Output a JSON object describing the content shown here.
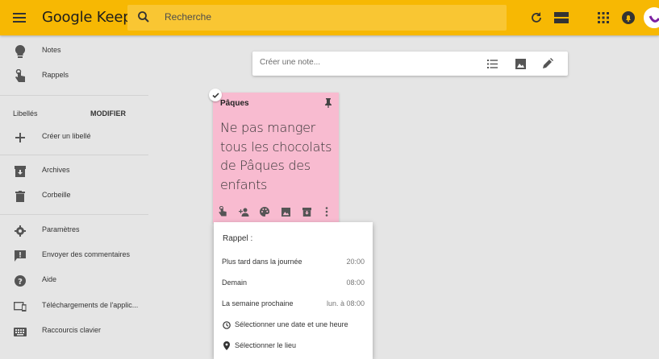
{
  "header": {
    "brand": "Google Keep",
    "search_placeholder": "Recherche"
  },
  "sidebar": {
    "items_top": [
      {
        "label": "Notes",
        "icon": "lightbulb-icon"
      },
      {
        "label": "Rappels",
        "icon": "reminder-hand-icon"
      }
    ],
    "labels_section": "Libellés",
    "modify": "MODIFIER",
    "create_label": "Créer un libellé",
    "items_mid": [
      {
        "label": "Archives",
        "icon": "archive-icon"
      },
      {
        "label": "Corbeille",
        "icon": "trash-icon"
      }
    ],
    "items_bottom": [
      {
        "label": "Paramètres",
        "icon": "gear-icon"
      },
      {
        "label": "Envoyer des commentaires",
        "icon": "feedback-icon"
      },
      {
        "label": "Aide",
        "icon": "help-icon"
      },
      {
        "label": "Téléchargements de l'applic...",
        "icon": "devices-icon"
      },
      {
        "label": "Raccourcis clavier",
        "icon": "keyboard-icon"
      }
    ]
  },
  "take_note": {
    "placeholder": "Créer une note..."
  },
  "note": {
    "title": "Pâques",
    "body": "Ne pas manger tous les chocolats de Pâques des enfants",
    "color": "#f8bbd0"
  },
  "reminder_popup": {
    "title": "Rappel :",
    "options": [
      {
        "label": "Plus tard dans la journée",
        "time": "20:00"
      },
      {
        "label": "Demain",
        "time": "08:00"
      },
      {
        "label": "La semaine prochaine",
        "time": "lun. à 08:00"
      }
    ],
    "pick_date": "Sélectionner une date et une heure",
    "pick_place": "Sélectionner le lieu"
  },
  "colors": {
    "header": "#f7b803",
    "search": "#f9c633",
    "background": "#e5e5e5"
  }
}
